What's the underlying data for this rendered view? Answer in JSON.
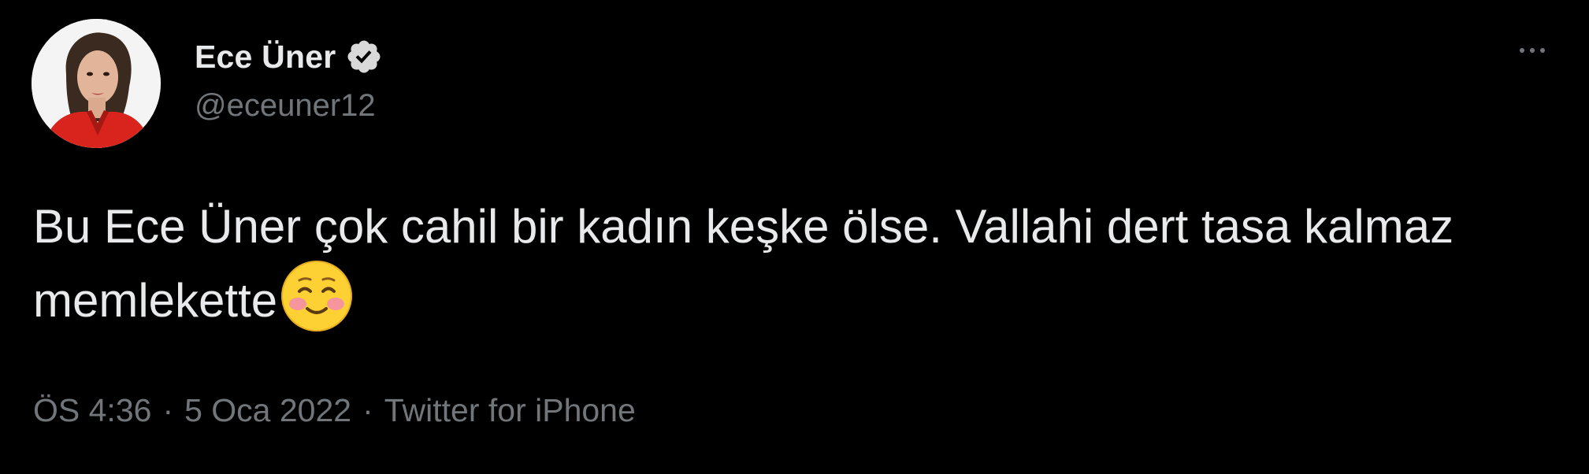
{
  "author": {
    "display_name": "Ece Üner",
    "handle": "@eceuner12",
    "verified": true,
    "avatar": "profile-photo"
  },
  "tweet": {
    "text": "Bu Ece Üner çok cahil bir kadın keşke ölse. Vallahi dert tasa kalmaz memlekette",
    "emoji": "smiling-face-with-blush-emoji"
  },
  "meta": {
    "time": "ÖS 4:36",
    "separator": "·",
    "date": "5 Oca 2022",
    "source": "Twitter for iPhone"
  },
  "icons": {
    "more": "more-options-icon",
    "verified": "verified-badge-icon"
  },
  "colors": {
    "background": "#000000",
    "primary_text": "#e7e9ea",
    "secondary_text": "#71767b"
  }
}
